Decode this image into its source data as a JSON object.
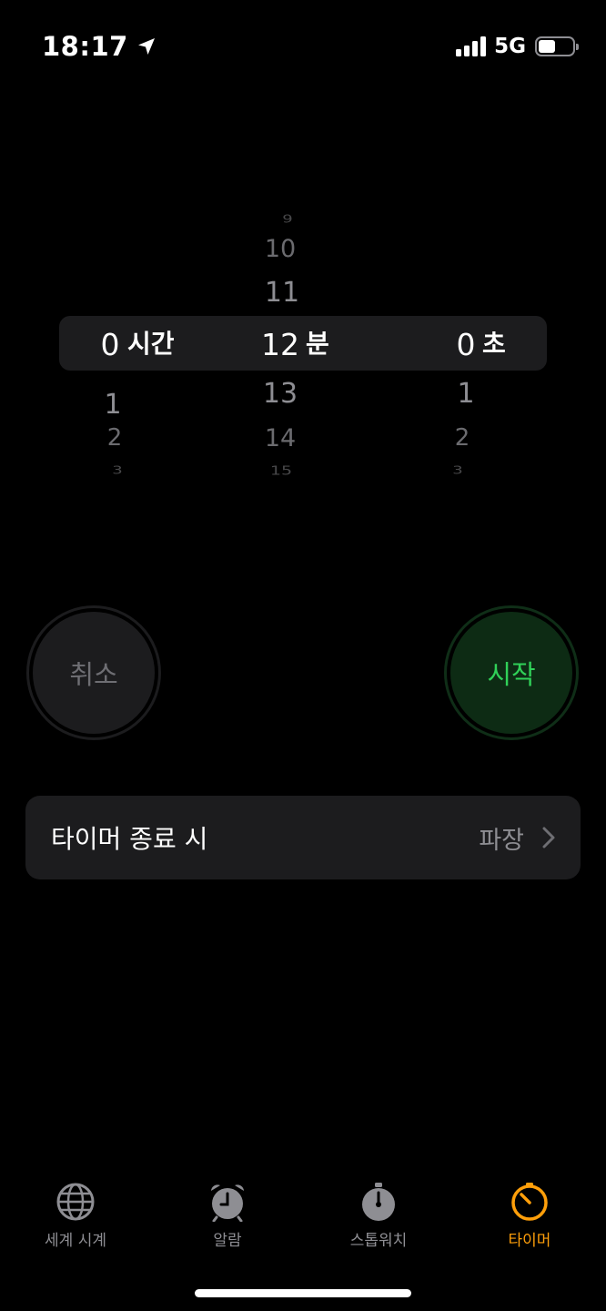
{
  "status_bar": {
    "time": "18:17",
    "network": "5G",
    "location_icon": "location-arrow-icon",
    "battery_level": 0.5
  },
  "picker": {
    "hours": {
      "above": [
        "",
        "",
        ""
      ],
      "selected": "0",
      "unit": "시간",
      "below": [
        "1",
        "2",
        "3"
      ]
    },
    "minutes": {
      "above": [
        "9",
        "10",
        "11"
      ],
      "selected": "12",
      "unit": "분",
      "below": [
        "13",
        "14",
        "15"
      ]
    },
    "seconds": {
      "above": [
        "",
        "",
        ""
      ],
      "selected": "0",
      "unit": "초",
      "below": [
        "1",
        "2",
        "3"
      ]
    }
  },
  "buttons": {
    "cancel_label": "취소",
    "start_label": "시작"
  },
  "end_row": {
    "label": "타이머 종료 시",
    "value": "파장"
  },
  "tabs": [
    {
      "label": "세계 시계",
      "icon": "globe-icon"
    },
    {
      "label": "알람",
      "icon": "alarm-clock-icon"
    },
    {
      "label": "스톱워치",
      "icon": "stopwatch-icon"
    },
    {
      "label": "타이머",
      "icon": "timer-icon",
      "active": true
    }
  ],
  "colors": {
    "accent": "#ff9f0a",
    "start_text": "#30d158",
    "start_bg": "#0d2b14",
    "cancel_bg": "#1c1c1e"
  }
}
